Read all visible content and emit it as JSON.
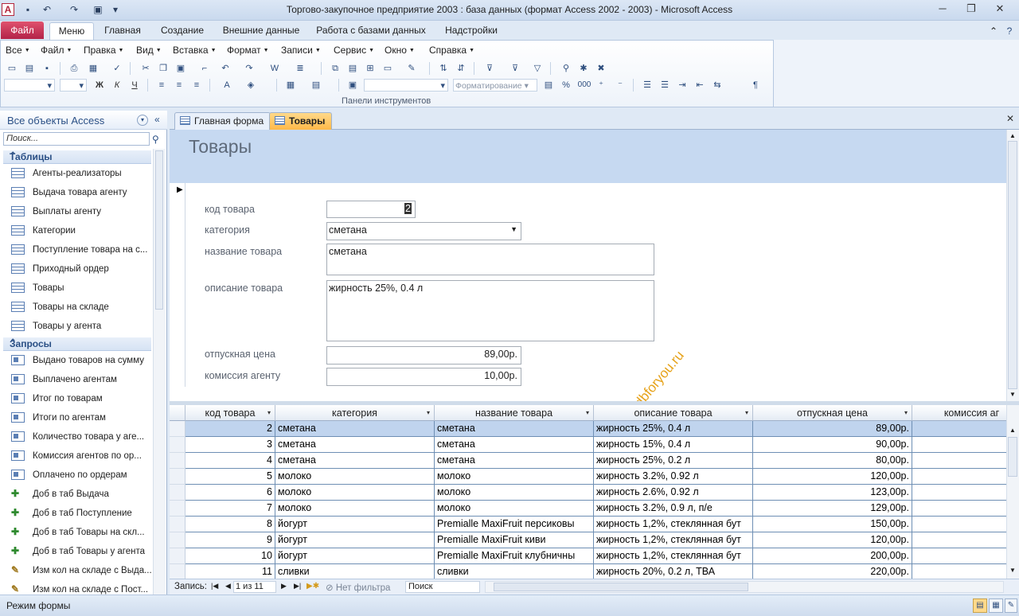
{
  "window": {
    "title": "Торгово-закупочное предприятие 2003 : база данных (формат Access 2002 - 2003)  -  Microsoft Access",
    "app_icon": "A"
  },
  "ribbon_tabs": [
    "Файл",
    "Меню",
    "Главная",
    "Создание",
    "Внешние данные",
    "Работа с базами данных",
    "Надстройки"
  ],
  "menu": [
    "Все",
    "Файл",
    "Правка",
    "Вид",
    "Вставка",
    "Формат",
    "Записи",
    "Сервис",
    "Окно",
    "Справка"
  ],
  "toolbar": {
    "group_label": "Панели инструментов",
    "format_dropdown": "Форматирование",
    "percent": "%",
    "thousands": "000"
  },
  "nav": {
    "title": "Все объекты Access",
    "search_placeholder": "Поиск...",
    "tables_header": "Таблицы",
    "tables": [
      "Агенты-реализаторы",
      "Выдача товара агенту",
      "Выплаты агенту",
      "Категории",
      "Поступление товара на с...",
      "Приходный ордер",
      "Товары",
      "Товары на складе",
      "Товары у агента"
    ],
    "queries_header": "Запросы",
    "queries": [
      {
        "label": "Выдано товаров на сумму",
        "icon": "select-query-icon"
      },
      {
        "label": "Выплачено агентам",
        "icon": "select-query-icon"
      },
      {
        "label": "Итог по товарам",
        "icon": "select-query-icon"
      },
      {
        "label": "Итоги по агентам",
        "icon": "select-query-icon"
      },
      {
        "label": "Количество товара у аге...",
        "icon": "select-query-icon"
      },
      {
        "label": "Комиссия агентов по ор...",
        "icon": "select-query-icon"
      },
      {
        "label": "Оплачено по ордерам",
        "icon": "select-query-icon"
      },
      {
        "label": "Доб в таб Выдача",
        "icon": "append-query-icon"
      },
      {
        "label": "Доб в таб Поступление",
        "icon": "append-query-icon"
      },
      {
        "label": "Доб в таб Товары на скл...",
        "icon": "append-query-icon"
      },
      {
        "label": "Доб в таб Товары у агента",
        "icon": "append-query-icon"
      },
      {
        "label": "Изм кол на складе с Выда...",
        "icon": "update-query-icon"
      },
      {
        "label": "Изм кол на складе с Пост...",
        "icon": "update-query-icon"
      }
    ]
  },
  "doc_tabs": [
    "Главная форма",
    "Товары"
  ],
  "form": {
    "title": "Товары",
    "fields": {
      "code": {
        "label": "код товара",
        "value": "2"
      },
      "category": {
        "label": "категория",
        "value": "сметана"
      },
      "name": {
        "label": "название товара",
        "value": "сметана"
      },
      "description": {
        "label": "описание товара",
        "value": "жирность 25%, 0.4 л"
      },
      "price": {
        "label": "отпускная цена",
        "value": "89,00р."
      },
      "commission": {
        "label": "комиссия агенту",
        "value": "10,00р."
      }
    },
    "watermark": "dbforyou.ru"
  },
  "datasheet": {
    "columns": [
      "код товара",
      "категория",
      "название товара",
      "описание товара",
      "отпускная цена",
      "комиссия аг"
    ],
    "rows": [
      [
        "2",
        "сметана",
        "сметана",
        "жирность 25%, 0.4 л",
        "89,00р."
      ],
      [
        "3",
        "сметана",
        "сметана",
        "жирность 15%, 0.4 л",
        "90,00р."
      ],
      [
        "4",
        "сметана",
        "сметана",
        "жирность 25%, 0.2 л",
        "80,00р."
      ],
      [
        "5",
        "молоко",
        "молоко",
        "жирность 3.2%, 0.92 л",
        "120,00р."
      ],
      [
        "6",
        "молоко",
        "молоко",
        "жирность 2.6%, 0.92 л",
        "123,00р."
      ],
      [
        "7",
        "молоко",
        "молоко",
        "жирность 3.2%, 0.9 л, п/е",
        "129,00р."
      ],
      [
        "8",
        "йогурт",
        "Premialle MaxiFruit персиковы",
        "жирность 1,2%, стеклянная бут",
        "150,00р."
      ],
      [
        "9",
        "йогурт",
        "Premialle MaxiFruit киви",
        "жирность 1,2%, стеклянная бут",
        "120,00р."
      ],
      [
        "10",
        "йогурт",
        "Premialle MaxiFruit клубничны",
        "жирность 1,2%, стеклянная бут",
        "200,00р."
      ],
      [
        "11",
        "сливки",
        "сливки",
        "жирность 20%, 0.2 л, ТВА",
        "220,00р."
      ]
    ]
  },
  "record_nav": {
    "label": "Запись:",
    "position": "1 из 11",
    "filter": "Нет фильтра",
    "search": "Поиск"
  },
  "status": {
    "text": "Режим формы"
  }
}
